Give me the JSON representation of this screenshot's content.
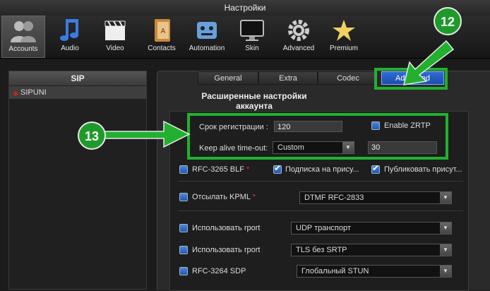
{
  "window": {
    "title": "Настройки"
  },
  "toolbar": {
    "items": [
      {
        "label": "Accounts",
        "icon": "accounts-icon"
      },
      {
        "label": "Audio",
        "icon": "music-note-icon"
      },
      {
        "label": "Video",
        "icon": "clapperboard-icon"
      },
      {
        "label": "Contacts",
        "icon": "address-book-icon"
      },
      {
        "label": "Automation",
        "icon": "robot-icon"
      },
      {
        "label": "Skin",
        "icon": "monitor-icon"
      },
      {
        "label": "Advanced",
        "icon": "gear-icon"
      },
      {
        "label": "Premium",
        "icon": "star-icon"
      }
    ]
  },
  "sidebar": {
    "header": "SIP",
    "accounts": [
      {
        "name": "SIPUNI"
      }
    ]
  },
  "tabs": [
    {
      "label": "General"
    },
    {
      "label": "Extra"
    },
    {
      "label": "Codec"
    },
    {
      "label": "Advanced"
    }
  ],
  "section": {
    "title_line1": "Расширенные настройки",
    "title_line2": "аккаунта"
  },
  "form": {
    "registration_label": "Срок регистрации :",
    "registration_value": "120",
    "zrtp_label": "Enable ZRTP",
    "keepalive_label": "Keep alive time-out:",
    "keepalive_mode": "Custom",
    "keepalive_value": "30",
    "rfc3265_label": "RFC-3265 BLF",
    "required_mark": "*",
    "subscribe_label": "Подписка на прису...",
    "publish_label": "Публиковать присут...",
    "kpml_label": "Отсылать KPML",
    "kpml_value": "DTMF RFC-2833",
    "rport1_label": "Использовать rport",
    "rport1_value": "UDP транспорт",
    "rport2_label": "Использовать rport",
    "rport2_value": "TLS без SRTP",
    "rfc3264_label": "RFC-3264 SDP",
    "rfc3264_value": "Глобальный STUN"
  },
  "annotations": {
    "badge1": "12",
    "badge2": "13"
  },
  "colors": {
    "accent": "#2e6bd6",
    "highlight": "#22b030"
  }
}
